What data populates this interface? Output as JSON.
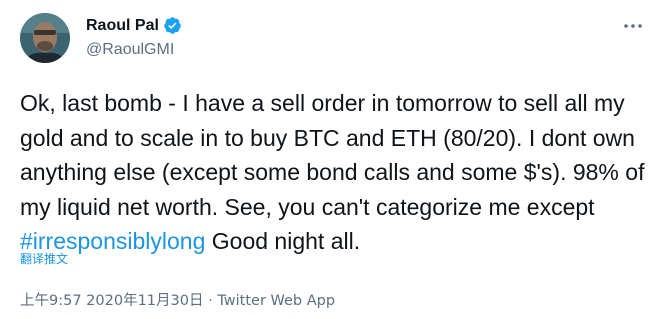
{
  "author": {
    "display_name": "Raoul Pal",
    "handle": "@RaoulGMI",
    "avatar_icon": "profile-photo",
    "verified_icon": "verified-badge-icon"
  },
  "tweet": {
    "text_before_hashtag": "Ok, last bomb - I have a sell order in tomorrow to sell all my gold and to scale in to buy BTC and ETH (80/20). I dont own anything else (except some bond calls and some $'s). 98% of my liquid net worth. See, you can't categorize me except ",
    "hashtag": "#irresponsiblylong",
    "text_after_hashtag": " Good night all.",
    "translate_label": "翻译推文"
  },
  "meta": {
    "time": "上午9:57",
    "separator": "·",
    "date": "2020年11月30日",
    "source": "Twitter Web App"
  },
  "colors": {
    "accent": "#1b95e0",
    "secondary_text": "#5b7083",
    "primary_text": "#0f1419"
  },
  "more_menu_icon": "more-horizontal-icon"
}
